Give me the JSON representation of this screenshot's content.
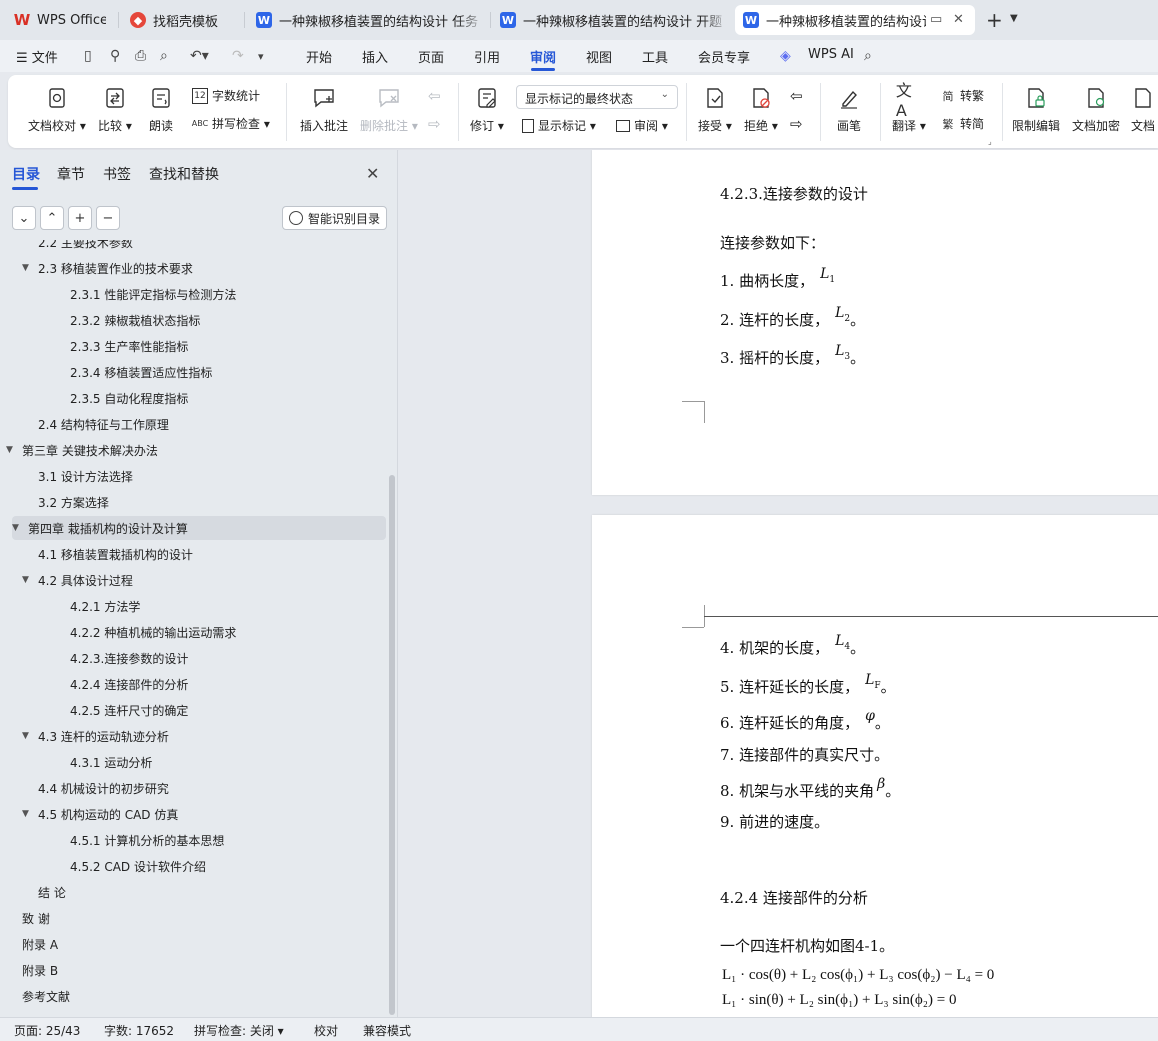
{
  "tabs": [
    {
      "label": "WPS Office",
      "icon": "wps-logo-icon"
    },
    {
      "label": "找稻壳模板",
      "icon": "docer-icon"
    },
    {
      "label": "一种辣椒移植装置的结构设计 任务书",
      "icon": "word-doc-icon"
    },
    {
      "label": "一种辣椒移植装置的结构设计 开题报告",
      "icon": "word-doc-icon"
    },
    {
      "label": "一种辣椒移植装置的结构设计",
      "icon": "word-doc-icon"
    }
  ],
  "menu": {
    "file": "文件",
    "items": [
      "开始",
      "插入",
      "页面",
      "引用",
      "审阅",
      "视图",
      "工具",
      "会员专享"
    ],
    "active": "审阅",
    "wps_ai": "WPS AI"
  },
  "ribbon": {
    "doc_check": "文档校对",
    "compare": "比较",
    "read_aloud": "朗读",
    "word_count": "字数统计",
    "spell_check": "拼写检查",
    "insert_comment": "插入批注",
    "delete_comment": "删除批注",
    "revise": "修订",
    "display_mode": "显示标记的最终状态",
    "show_markup": "显示标记",
    "review": "审阅",
    "accept": "接受",
    "reject": "拒绝",
    "pen": "画笔",
    "translate": "翻译",
    "to_traditional": "转繁",
    "to_simplified": "转简",
    "restrict_edit": "限制编辑",
    "encrypt": "文档加密",
    "doc_more": "文档"
  },
  "nav": {
    "tabs": [
      "目录",
      "章节",
      "书签",
      "查找和替换"
    ],
    "smart_toc": "智能识别目录",
    "toc": [
      {
        "label": "2.2  主要技术参数",
        "level": 2,
        "tri": ""
      },
      {
        "label": "2.3 移植装置作业的技术要求",
        "level": 2,
        "tri": "▼"
      },
      {
        "label": "2.3.1  性能评定指标与检测方法",
        "level": 3,
        "tri": ""
      },
      {
        "label": "2.3.2 辣椒栽植状态指标",
        "level": 3,
        "tri": ""
      },
      {
        "label": "2.3.3  生产率性能指标",
        "level": 3,
        "tri": ""
      },
      {
        "label": "2.3.4 移植装置适应性指标",
        "level": 3,
        "tri": ""
      },
      {
        "label": "2.3.5 自动化程度指标",
        "level": 3,
        "tri": ""
      },
      {
        "label": "2.4  结构特征与工作原理",
        "level": 2,
        "tri": ""
      },
      {
        "label": "第三章  关键技术解决办法",
        "level": 1,
        "tri": "▼"
      },
      {
        "label": "3.1  设计方法选择",
        "level": 2,
        "tri": ""
      },
      {
        "label": "3.2  方案选择",
        "level": 2,
        "tri": ""
      },
      {
        "label": "第四章  栽插机构的设计及计算",
        "level": 1,
        "tri": "▼"
      },
      {
        "label": "4.1  移植装置栽插机构的设计",
        "level": 2,
        "tri": ""
      },
      {
        "label": "4.2  具体设计过程",
        "level": 2,
        "tri": "▼"
      },
      {
        "label": "4.2.1  方法学",
        "level": 3,
        "tri": ""
      },
      {
        "label": "4.2.2  种植机械的输出运动需求",
        "level": 3,
        "tri": ""
      },
      {
        "label": "4.2.3.连接参数的设计",
        "level": 3,
        "tri": ""
      },
      {
        "label": "4.2.4    连接部件的分析",
        "level": 3,
        "tri": ""
      },
      {
        "label": "4.2.5  连杆尺寸的确定",
        "level": 3,
        "tri": ""
      },
      {
        "label": "4.3  连杆的运动轨迹分析",
        "level": 2,
        "tri": "▼"
      },
      {
        "label": "4.3.1  运动分析",
        "level": 3,
        "tri": ""
      },
      {
        "label": "4.4  机械设计的初步研究",
        "level": 2,
        "tri": ""
      },
      {
        "label": "4.5  机构运动的 CAD 仿真",
        "level": 2,
        "tri": "▼"
      },
      {
        "label": "4.5.1  计算机分析的基本思想",
        "level": 3,
        "tri": ""
      },
      {
        "label": "4.5.2 CAD 设计软件介绍",
        "level": 3,
        "tri": ""
      },
      {
        "label": "结    论",
        "level": 2,
        "tri": ""
      },
      {
        "label": "致    谢",
        "level": 1,
        "tri": ""
      },
      {
        "label": "附录 A",
        "level": 1,
        "tri": ""
      },
      {
        "label": "附录 B",
        "level": 1,
        "tri": ""
      },
      {
        "label": "参考文献",
        "level": 1,
        "tri": ""
      }
    ],
    "selected_index": 11
  },
  "doc": {
    "page1": {
      "heading": "4.2.3.连接参数的设计",
      "intro": "连接参数如下：",
      "items": [
        {
          "text": "1.  曲柄长度，",
          "sym": "L",
          "sub": "1",
          "end": ""
        },
        {
          "text": "2.  连杆的长度，",
          "sym": "L",
          "sub": "2",
          "end": "。"
        },
        {
          "text": "3.  摇杆的长度，",
          "sym": "L",
          "sub": "3",
          "end": "。"
        }
      ]
    },
    "page2": {
      "items": [
        {
          "text": "4.  机架的长度，",
          "sym": "L",
          "sub": "4",
          "end": "。"
        },
        {
          "text": "5.  连杆延长的长度，",
          "sym": "L",
          "sub": "F",
          "end": "。"
        },
        {
          "text": "6.  连杆延长的角度，",
          "sym": "φ",
          "sub": "",
          "end": "。"
        },
        {
          "text": "7.  连接部件的真实尺寸。",
          "sym": "",
          "sub": "",
          "end": ""
        },
        {
          "text": "8.  机架与水平线的夹角",
          "sym": "β",
          "sub": "",
          "end": "。"
        },
        {
          "text": "9.  前进的速度。",
          "sym": "",
          "sub": "",
          "end": ""
        }
      ],
      "heading": "4.2.4    连接部件的分析",
      "para": "一个四连杆机构如图4-1。",
      "eq1": "L₁ · cos(θ) + L₂ cos(ϕ₁) + L₃ cos(ϕ₂) − L₄ = 0",
      "eq2": "L₁ · sin(θ) + L₂ sin(ϕ₁) + L₃ sin(ϕ₂) = 0"
    }
  },
  "status": {
    "page": "页面: 25/43",
    "words": "字数: 17652",
    "spell": "拼写检查: 关闭",
    "proof": "校对",
    "compat": "兼容模式"
  },
  "colors": {
    "accent": "#2657d6",
    "wps_red": "#d93025",
    "word_blue": "#2e66e8"
  }
}
